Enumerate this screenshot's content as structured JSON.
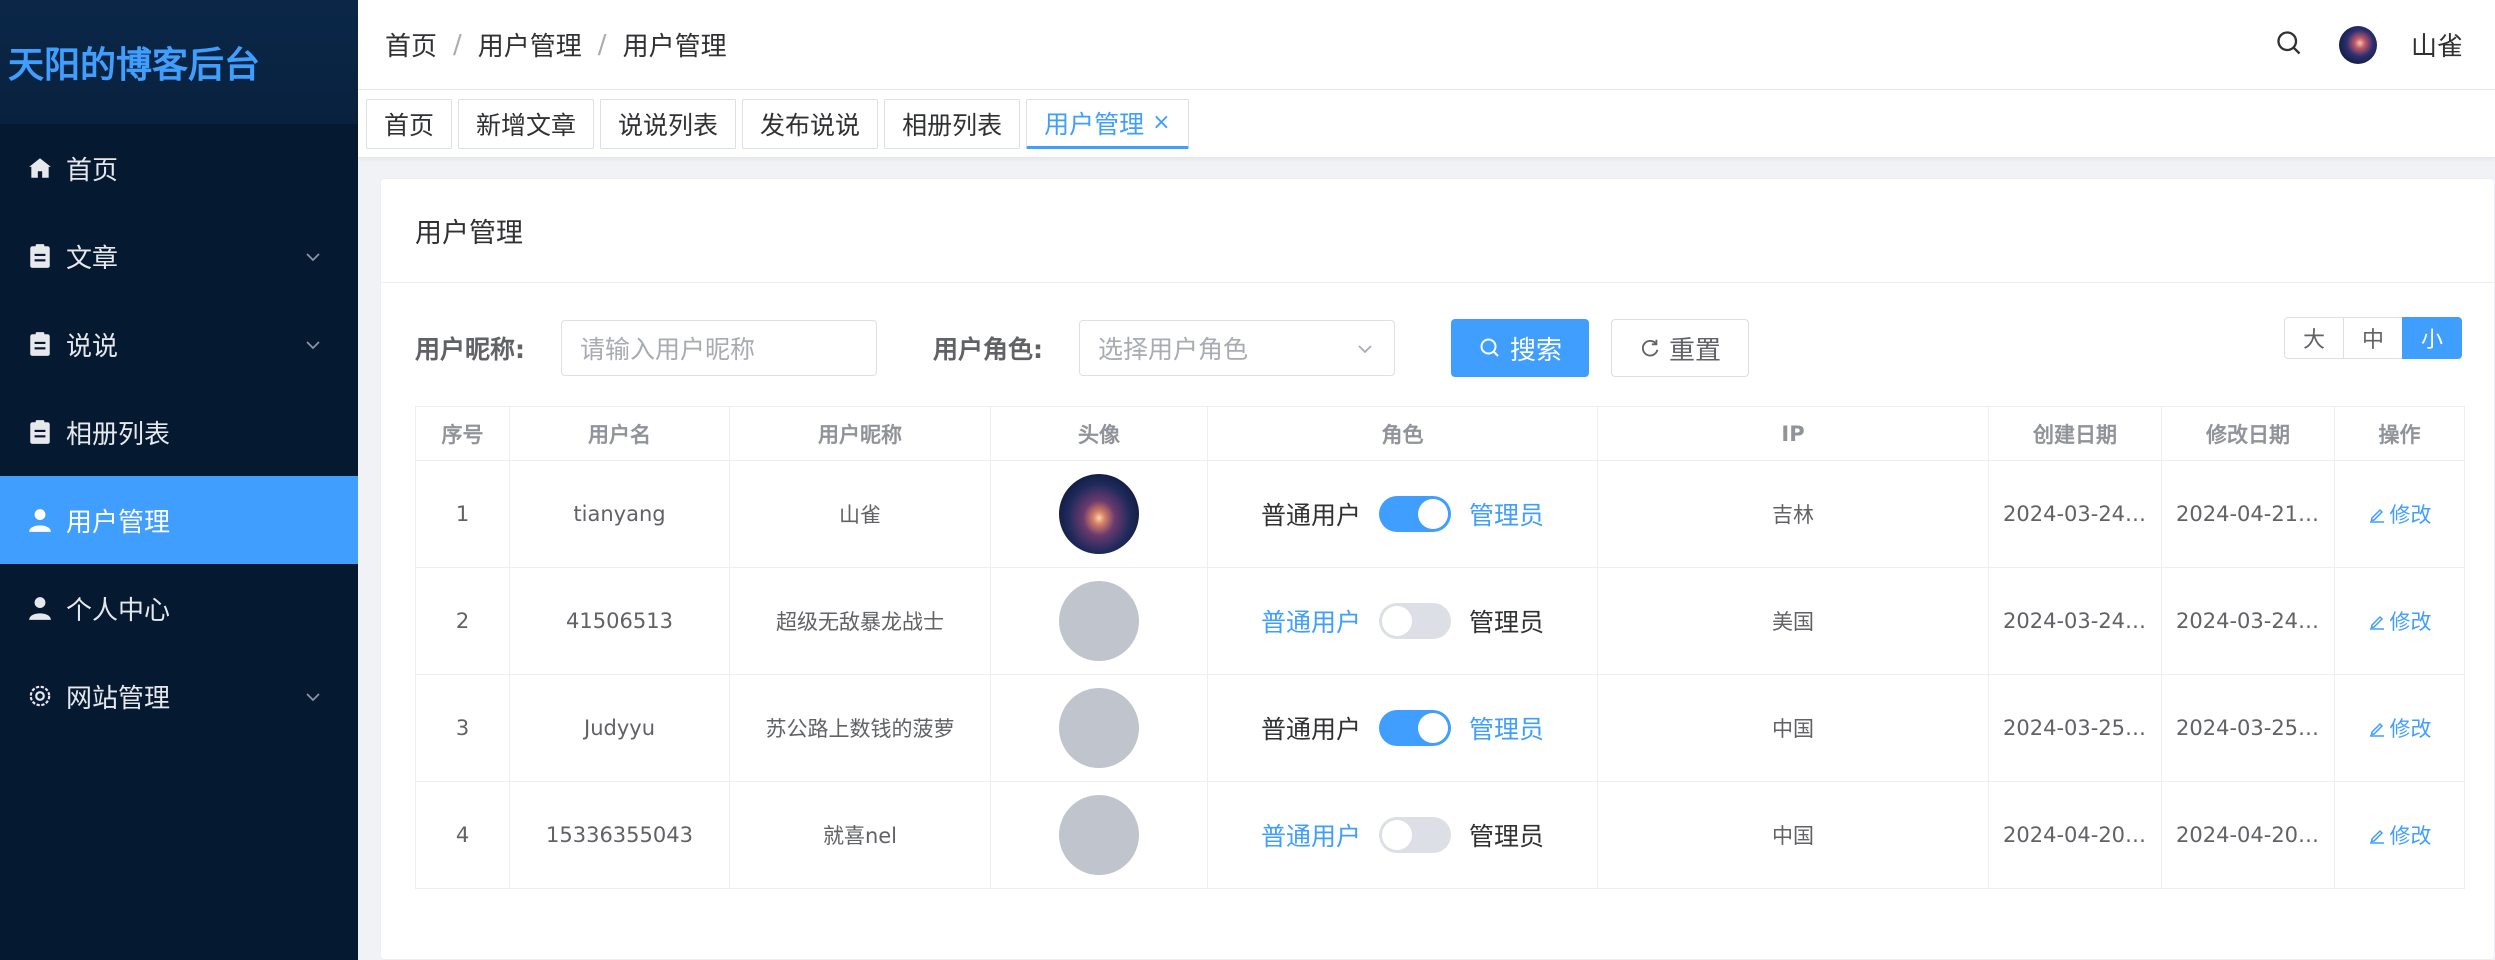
{
  "sidebar": {
    "brand": "天阳的博客后台",
    "items": [
      {
        "label": "首页"
      },
      {
        "label": "文章"
      },
      {
        "label": "说说"
      },
      {
        "label": "相册列表"
      },
      {
        "label": "用户管理"
      },
      {
        "label": "个人中心"
      },
      {
        "label": "网站管理"
      }
    ]
  },
  "header": {
    "breadcrumb": [
      "首页",
      "用户管理",
      "用户管理"
    ],
    "separator": "/",
    "username": "山雀"
  },
  "tabs": [
    {
      "label": "首页"
    },
    {
      "label": "新增文章"
    },
    {
      "label": "说说列表"
    },
    {
      "label": "发布说说"
    },
    {
      "label": "相册列表"
    },
    {
      "label": "用户管理",
      "close": "×"
    }
  ],
  "card": {
    "title": "用户管理",
    "filters": {
      "nickname_label": "用户昵称:",
      "nickname_placeholder": "请输入用户昵称",
      "role_label": "用户角色:",
      "role_placeholder": "选择用户角色",
      "search_label": "搜索",
      "reset_label": "重置"
    },
    "sizes": [
      "大",
      "中",
      "小"
    ],
    "table": {
      "headers": [
        "序号",
        "用户名",
        "用户昵称",
        "头像",
        "角色",
        "IP",
        "创建日期",
        "修改日期",
        "操作"
      ],
      "role_off": "普通用户",
      "role_on": "管理员",
      "edit_label": "修改",
      "rows": [
        {
          "idx": "1",
          "username": "tianyang",
          "nickname": "山雀",
          "admin": true,
          "ip": "吉林",
          "created": "2024-03-24 ...",
          "modified": "2024-04-21 ..."
        },
        {
          "idx": "2",
          "username": "41506513",
          "nickname": "超级无敌暴龙战士",
          "admin": false,
          "ip": "美国",
          "created": "2024-03-24 ...",
          "modified": "2024-03-24 ..."
        },
        {
          "idx": "3",
          "username": "Judyyu",
          "nickname": "苏公路上数钱的菠萝",
          "admin": true,
          "ip": "中国",
          "created": "2024-03-25 ...",
          "modified": "2024-03-25 ..."
        },
        {
          "idx": "4",
          "username": "15336355043",
          "nickname": "就喜nel",
          "admin": false,
          "ip": "中国",
          "created": "2024-04-20 ...",
          "modified": "2024-04-20 ..."
        }
      ]
    }
  },
  "colors": {
    "primary": "#409eff",
    "sidebar_bg": "#051931"
  }
}
